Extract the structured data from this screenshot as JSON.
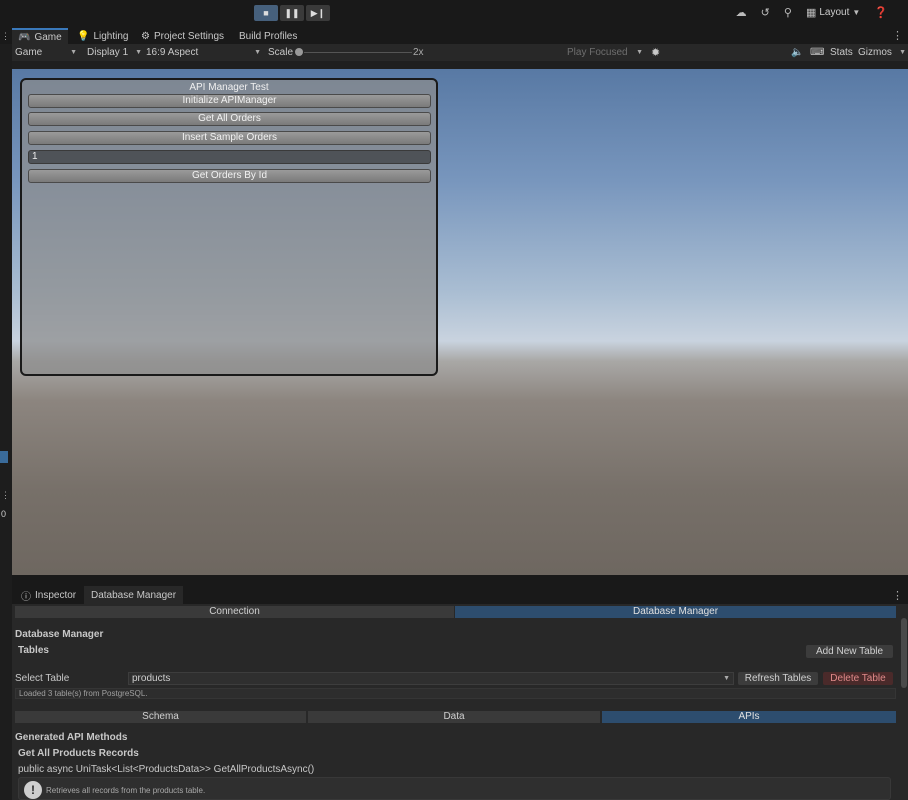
{
  "toolbar": {
    "play_icon": "stop-square-icon",
    "pause_icon": "pause-icon",
    "step_icon": "step-icon",
    "layout_label": "Layout"
  },
  "tabs": [
    {
      "label": "Game",
      "icon": "gamepad-icon"
    },
    {
      "label": "Lighting",
      "icon": "bulb-icon"
    },
    {
      "label": "Project Settings",
      "icon": "gear-icon"
    },
    {
      "label": "Build Profiles",
      "icon": ""
    }
  ],
  "game_toolbar": {
    "view": "Game",
    "display": "Display 1",
    "aspect": "16:9 Aspect",
    "scale_label": "Scale",
    "scale_value": "2x",
    "play_mode": "Play Focused",
    "stats": "Stats",
    "gizmos": "Gizmos"
  },
  "game_panel": {
    "title": "API Manager Test",
    "buttons": [
      "Initialize APIManager",
      "Get All Orders",
      "Insert Sample Orders"
    ],
    "id_input": "1",
    "get_by_id": "Get Orders By Id"
  },
  "left_strip": {
    "badge": "0"
  },
  "bottom_tabs": [
    {
      "label": "Inspector",
      "icon": "info-icon"
    },
    {
      "label": "Database Manager",
      "icon": ""
    }
  ],
  "inspector": {
    "top_segments": [
      "Connection",
      "Database Manager"
    ],
    "header": "Database Manager",
    "tables_label": "Tables",
    "add_table": "Add New Table",
    "select_label": "Select Table",
    "selected_table": "products",
    "refresh": "Refresh Tables",
    "delete": "Delete Table",
    "status": "Loaded 3 table(s) from PostgreSQL.",
    "sub_segments": [
      "Schema",
      "Data",
      "APIs"
    ],
    "generated_title": "Generated API Methods",
    "method_title": "Get All Products Records",
    "method_signature": "public async UniTask<List<ProductsData>> GetAllProductsAsync()",
    "method_desc": "Retrieves all records from the products table."
  },
  "colors": {
    "accent": "#3a79bb",
    "selected_segment": "#2d4d6e",
    "danger": "#e08a8a"
  }
}
